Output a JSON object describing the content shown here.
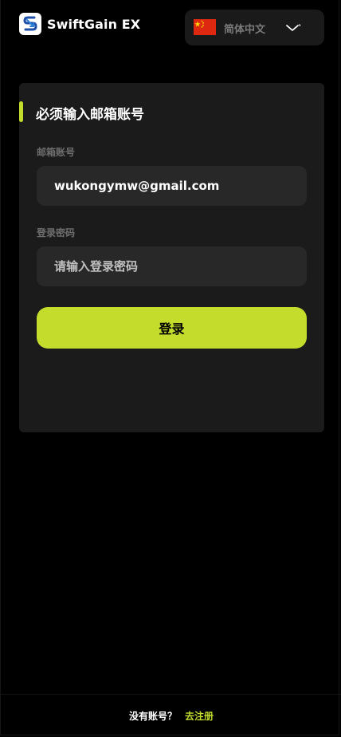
{
  "header": {
    "brand_name": "SwiftGain EX",
    "logo_icon": "swiftgain-logo-icon",
    "language": {
      "label": "简体中文",
      "flag_icon": "china-flag-icon",
      "chevron_icon": "chevron-down-icon"
    }
  },
  "login_card": {
    "title": "必须输入邮箱账号",
    "email": {
      "label": "邮箱账号",
      "value": "wukongymw@gmail.com"
    },
    "password": {
      "label": "登录密码",
      "placeholder": "请输入登录密码",
      "value": ""
    },
    "submit_label": "登录"
  },
  "footer": {
    "question": "没有账号？",
    "register_link": "去注册"
  },
  "colors": {
    "accent": "#c4dd2c",
    "background": "#000000",
    "card": "#1b1b1b",
    "input": "#282828"
  }
}
